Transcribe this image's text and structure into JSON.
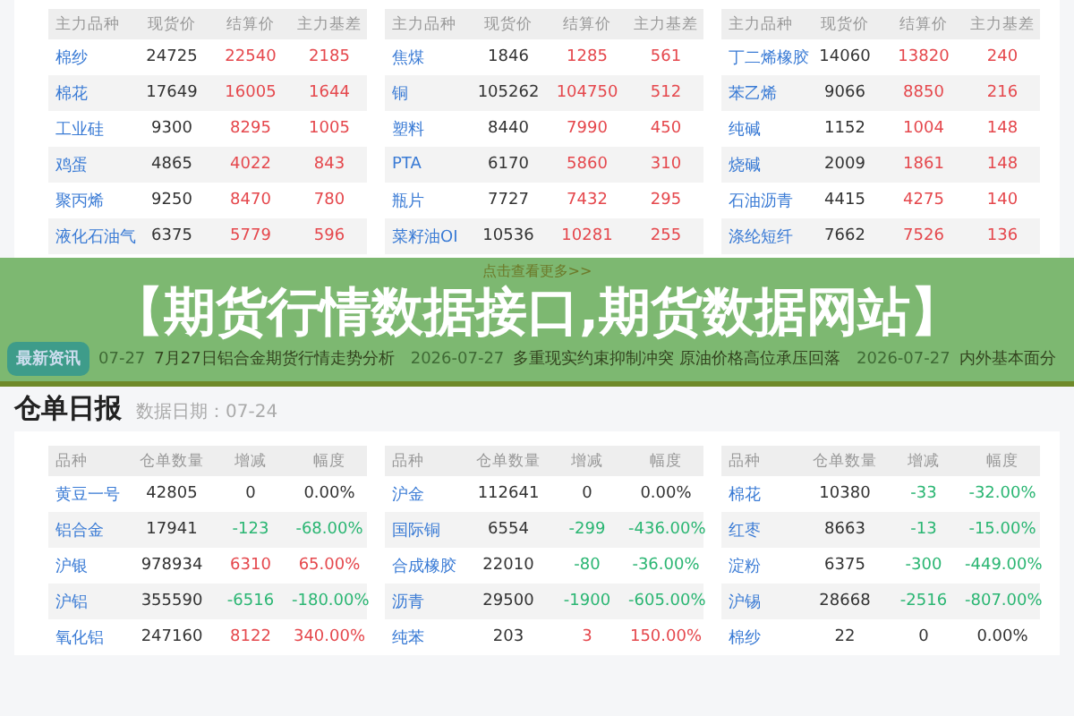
{
  "basis_tables": [
    {
      "columns": [
        "主力品种",
        "现货价",
        "结算价",
        "主力基差"
      ],
      "rows": [
        {
          "name": "棉纱",
          "spot": "24725",
          "settle": "22540",
          "basis": "2185",
          "kind": "up"
        },
        {
          "name": "棉花",
          "spot": "17649",
          "settle": "16005",
          "basis": "1644",
          "kind": "up"
        },
        {
          "name": "工业硅",
          "spot": "9300",
          "settle": "8295",
          "basis": "1005",
          "kind": "up"
        },
        {
          "name": "鸡蛋",
          "spot": "4865",
          "settle": "4022",
          "basis": "843",
          "kind": "up"
        },
        {
          "name": "聚丙烯",
          "spot": "9250",
          "settle": "8470",
          "basis": "780",
          "kind": "up"
        },
        {
          "name": "液化石油气",
          "spot": "6375",
          "settle": "5779",
          "basis": "596",
          "kind": "up"
        }
      ]
    },
    {
      "columns": [
        "主力品种",
        "现货价",
        "结算价",
        "主力基差"
      ],
      "rows": [
        {
          "name": "焦煤",
          "spot": "1846",
          "settle": "1285",
          "basis": "561",
          "kind": "up"
        },
        {
          "name": "铜",
          "spot": "105262",
          "settle": "104750",
          "basis": "512",
          "kind": "up"
        },
        {
          "name": "塑料",
          "spot": "8440",
          "settle": "7990",
          "basis": "450",
          "kind": "up"
        },
        {
          "name": "PTA",
          "spot": "6170",
          "settle": "5860",
          "basis": "310",
          "kind": "up"
        },
        {
          "name": "瓶片",
          "spot": "7727",
          "settle": "7432",
          "basis": "295",
          "kind": "up"
        },
        {
          "name": "菜籽油OI",
          "spot": "10536",
          "settle": "10281",
          "basis": "255",
          "kind": "up"
        }
      ]
    },
    {
      "columns": [
        "主力品种",
        "现货价",
        "结算价",
        "主力基差"
      ],
      "rows": [
        {
          "name": "丁二烯橡胶",
          "spot": "14060",
          "settle": "13820",
          "basis": "240",
          "kind": "up"
        },
        {
          "name": "苯乙烯",
          "spot": "9066",
          "settle": "8850",
          "basis": "216",
          "kind": "up"
        },
        {
          "name": "纯碱",
          "spot": "1152",
          "settle": "1004",
          "basis": "148",
          "kind": "up"
        },
        {
          "name": "烧碱",
          "spot": "2009",
          "settle": "1861",
          "basis": "148",
          "kind": "up"
        },
        {
          "name": "石油沥青",
          "spot": "4415",
          "settle": "4275",
          "basis": "140",
          "kind": "up"
        },
        {
          "name": "涤纶短纤",
          "spot": "7662",
          "settle": "7526",
          "basis": "136",
          "kind": "up"
        }
      ]
    }
  ],
  "more_link": "点击查看更多>>",
  "banner_title": "【期货行情数据接口,期货数据网站】",
  "news": {
    "badge": "最新资讯",
    "items": [
      {
        "date": "07-27",
        "title": "7月27日铝合金期货行情走势分析"
      },
      {
        "date": "2026-07-27",
        "title": "多重现实约束抑制冲突 原油价格高位承压回落"
      },
      {
        "date": "2026-07-27",
        "title": "内外基本面分"
      }
    ]
  },
  "warrant_section": {
    "title": "仓单日报",
    "date": "数据日期：07-24"
  },
  "warrant_tables": [
    {
      "columns": [
        "品种",
        "仓单数量",
        "增减",
        "幅度"
      ],
      "rows": [
        {
          "name": "黄豆一号",
          "qty": "42805",
          "change": "0",
          "pct": "0.00%",
          "kind": "flat"
        },
        {
          "name": "铝合金",
          "qty": "17941",
          "change": "-123",
          "pct": "-68.00%",
          "kind": "down"
        },
        {
          "name": "沪银",
          "qty": "978934",
          "change": "6310",
          "pct": "65.00%",
          "kind": "up"
        },
        {
          "name": "沪铝",
          "qty": "355590",
          "change": "-6516",
          "pct": "-180.00%",
          "kind": "down"
        },
        {
          "name": "氧化铝",
          "qty": "247160",
          "change": "8122",
          "pct": "340.00%",
          "kind": "up"
        }
      ]
    },
    {
      "columns": [
        "品种",
        "仓单数量",
        "增减",
        "幅度"
      ],
      "rows": [
        {
          "name": "沪金",
          "qty": "112641",
          "change": "0",
          "pct": "0.00%",
          "kind": "flat"
        },
        {
          "name": "国际铜",
          "qty": "6554",
          "change": "-299",
          "pct": "-436.00%",
          "kind": "down"
        },
        {
          "name": "合成橡胶",
          "qty": "22010",
          "change": "-80",
          "pct": "-36.00%",
          "kind": "down"
        },
        {
          "name": "沥青",
          "qty": "29500",
          "change": "-1900",
          "pct": "-605.00%",
          "kind": "down"
        },
        {
          "name": "纯苯",
          "qty": "203",
          "change": "3",
          "pct": "150.00%",
          "kind": "up"
        }
      ]
    },
    {
      "columns": [
        "品种",
        "仓单数量",
        "增减",
        "幅度"
      ],
      "rows": [
        {
          "name": "棉花",
          "qty": "10380",
          "change": "-33",
          "pct": "-32.00%",
          "kind": "down"
        },
        {
          "name": "红枣",
          "qty": "8663",
          "change": "-13",
          "pct": "-15.00%",
          "kind": "down"
        },
        {
          "name": "淀粉",
          "qty": "6375",
          "change": "-300",
          "pct": "-449.00%",
          "kind": "down"
        },
        {
          "name": "沪锡",
          "qty": "28668",
          "change": "-2516",
          "pct": "-807.00%",
          "kind": "down"
        },
        {
          "name": "棉纱",
          "qty": "22",
          "change": "0",
          "pct": "0.00%",
          "kind": "flat"
        }
      ]
    }
  ]
}
